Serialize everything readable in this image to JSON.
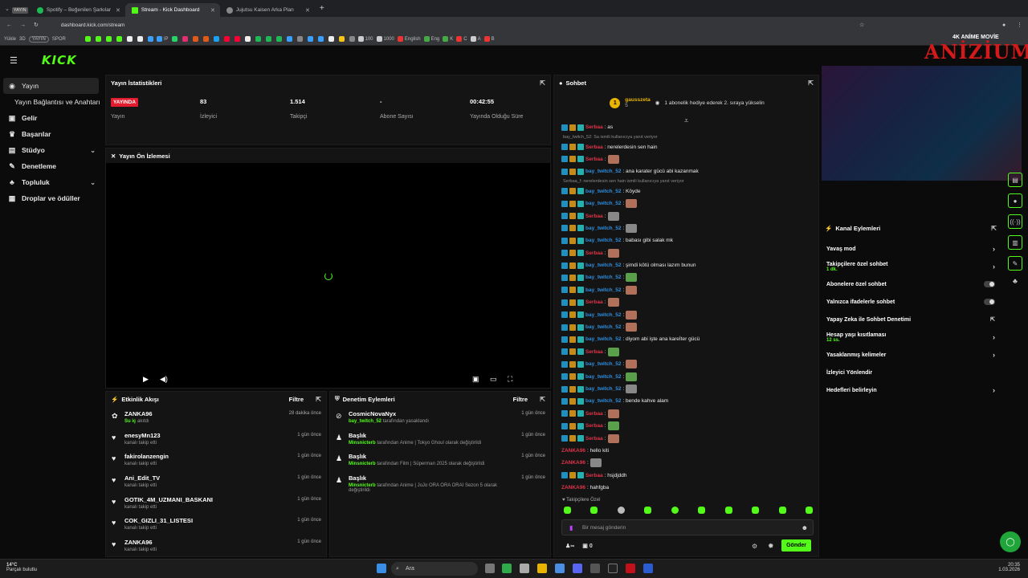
{
  "browser": {
    "tabs": [
      {
        "label": "YAYIN"
      },
      {
        "label": "Spotify – Beğenilen Şarkılar"
      },
      {
        "label": "Stream - Kick Dashboard"
      },
      {
        "label": "Jujutsu Kaisen Arka Plan"
      }
    ],
    "url": "dashboard.kick.com/stream",
    "bookmarks": [
      "Yükle",
      "3D",
      "YAYIN",
      "SPOR",
      "IP",
      "100",
      "1000",
      "English",
      "Eng",
      "K",
      "C",
      "A",
      "B"
    ]
  },
  "watermark": {
    "top": "4K ANİME MOVİE",
    "brand": "ANİZİUM"
  },
  "sidebar": {
    "items": [
      {
        "label": "Yayın",
        "icon": "broadcast-icon"
      },
      {
        "label": "Yayın Bağlantısı ve Anahtarı"
      },
      {
        "label": "Gelir",
        "icon": "money-icon"
      },
      {
        "label": "Başarılar",
        "icon": "trophy-icon"
      },
      {
        "label": "Stüdyo",
        "icon": "studio-icon"
      },
      {
        "label": "Denetleme",
        "icon": "wrench-icon"
      },
      {
        "label": "Topluluk",
        "icon": "community-icon"
      },
      {
        "label": "Droplar ve ödüller",
        "icon": "gift-icon"
      }
    ]
  },
  "stats": {
    "title": "Yayın İstatistikleri",
    "live_badge": "YAYINDA",
    "cells": [
      {
        "value": "",
        "label": "Yayın"
      },
      {
        "value": "83",
        "label": "İzleyici"
      },
      {
        "value": "1.514",
        "label": "Takipçi"
      },
      {
        "value": "-",
        "label": "Abone Sayısı"
      },
      {
        "value": "00:42:55",
        "label": "Yayında Olduğu Süre"
      }
    ]
  },
  "preview": {
    "title": "Yayın Ön İzlemesi"
  },
  "activity": {
    "title": "Etkinlik Akışı",
    "filter": "Filtre",
    "rows": [
      {
        "name": "ZANKA96",
        "sub": "Su iç",
        "sub2": "akıtdı",
        "time": "28 dakika önce"
      },
      {
        "name": "enesyMn123",
        "sub": "kanalı takip etti",
        "time": "1 gün önce"
      },
      {
        "name": "fakirolanzengin",
        "sub": "kanalı takip etti",
        "time": "1 gün önce"
      },
      {
        "name": "Ani_Edit_TV",
        "sub": "kanalı takip etti",
        "time": "1 gün önce"
      },
      {
        "name": "GOTIK_4M_UZMANI_BASKANI",
        "sub": "kanalı takip etti",
        "time": "1 gün önce"
      },
      {
        "name": "COK_GIZLI_31_LISTESI",
        "sub": "kanalı takip etti",
        "time": "1 gün önce"
      },
      {
        "name": "ZANKA96",
        "sub": "kanalı takip etti",
        "time": "1 gün önce"
      }
    ]
  },
  "moderation": {
    "title": "Denetim Eylemleri",
    "filter": "Filtre",
    "rows": [
      {
        "name": "CosmicNovaNyx",
        "actor": "bay_twitch_52",
        "text": "tarafından yasaklandı",
        "time": "1 gün önce"
      },
      {
        "name": "Başlık",
        "actor": "Minsnicterb",
        "text": "tarafından  Anime | Tokyo Ghoul olarak değiştirildi",
        "time": "1 gün önce"
      },
      {
        "name": "Başlık",
        "actor": "Minsnicterb",
        "text": "tarafından  Film | Süperman 2025 olarak değiştirildi",
        "time": "1 gün önce"
      },
      {
        "name": "Başlık",
        "actor": "Minsnicterb",
        "text": "tarafından  Anime | JoJo  ORA ORA ORAI Sezon 5 olarak değiştirildi",
        "time": "1 gün önce"
      }
    ]
  },
  "chat": {
    "title": "Sohbet",
    "pinned_user": "gausszeta",
    "pinned_level": "5",
    "pinned_text": "1 abonelik hediye ederek 2. sıraya yükselin",
    "messages": [
      {
        "user": "Serbaa",
        "text": ": as",
        "color": "#e0344a"
      },
      {
        "reply": "bay_twitch_52: Sa ismili kullanıcıya yanıt veriyor"
      },
      {
        "user": "Serbaa",
        "text": ": nerelerdesin sen hain",
        "color": "#e0344a"
      },
      {
        "user": "Serbaa",
        "text": ":",
        "color": "#e0344a",
        "emote": "emote"
      },
      {
        "user": "bay_twitch_52",
        "text": ": ana karater gücü abi kazanmak",
        "color": "#2f8fe0"
      },
      {
        "reply": "Serbaa_f: nerelerdesin sen hain ismili kullanıcıya yanıt veriyor"
      },
      {
        "user": "bay_twitch_52",
        "text": ": Köyde",
        "color": "#2f8fe0"
      },
      {
        "user": "bay_twitch_52",
        "text": ":",
        "color": "#2f8fe0",
        "emote": "emote"
      },
      {
        "user": "Serbaa",
        "text": ":",
        "color": "#e0344a",
        "emote": "emote g"
      },
      {
        "user": "bay_twitch_52",
        "text": ":",
        "color": "#2f8fe0",
        "emote": "emote g"
      },
      {
        "user": "bay_twitch_52",
        "text": ": babası gibi salak mk",
        "color": "#2f8fe0"
      },
      {
        "user": "Serbaa",
        "text": ":",
        "color": "#e0344a",
        "emote": "emote"
      },
      {
        "user": "bay_twitch_52",
        "text": ": şimdi kötü olması lazım bunun",
        "color": "#2f8fe0"
      },
      {
        "user": "bay_twitch_52",
        "text": ":",
        "color": "#2f8fe0",
        "emote": "emote f"
      },
      {
        "user": "bay_twitch_52",
        "text": ":",
        "color": "#2f8fe0",
        "emote": "emote"
      },
      {
        "user": "Serbaa",
        "text": ":",
        "color": "#e0344a",
        "emote": "emote"
      },
      {
        "user": "bay_twitch_52",
        "text": ":",
        "color": "#2f8fe0",
        "emote": "emote"
      },
      {
        "user": "bay_twitch_52",
        "text": ":",
        "color": "#2f8fe0",
        "emote": "emote"
      },
      {
        "user": "bay_twitch_52",
        "text": ": diyom abi işte ana kareİter gücü",
        "color": "#2f8fe0"
      },
      {
        "user": "Serbaa",
        "text": ":",
        "color": "#e0344a",
        "emote": "emote f"
      },
      {
        "user": "bay_twitch_52",
        "text": ":",
        "color": "#2f8fe0",
        "emote": "emote"
      },
      {
        "user": "bay_twitch_52",
        "text": ":",
        "color": "#2f8fe0",
        "emote": "emote f"
      },
      {
        "user": "bay_twitch_52",
        "text": ":",
        "color": "#2f8fe0",
        "emote": "emote g"
      },
      {
        "user": "bay_twitch_52",
        "text": ": bende kahve alam",
        "color": "#2f8fe0"
      },
      {
        "user": "Serbaa",
        "text": ":",
        "color": "#e0344a",
        "emote": "emote"
      },
      {
        "user": "Serbaa",
        "text": ":",
        "color": "#e0344a",
        "emote": "emote f"
      },
      {
        "user": "Serbaa",
        "text": ":",
        "color": "#e0344a",
        "emote": "emote"
      },
      {
        "user": "ZANKA96",
        "text": ": hello kiti",
        "color": "#e0344a",
        "nobadge": true
      },
      {
        "user": "ZANKA96",
        "text": ":",
        "color": "#e0344a",
        "nobadge": true,
        "emote": "emote g"
      },
      {
        "user": "Serbaa",
        "text": ": hsjdjddh",
        "color": "#e0344a"
      },
      {
        "user": "ZANKA96",
        "text": ": hahfgba",
        "color": "#e0344a",
        "nobadge": true
      }
    ],
    "followers_only": "Takipçilere Özel",
    "input_placeholder": "Bir mesaj gönderin",
    "viewers": "∞",
    "count": "0",
    "send": "Gönder"
  },
  "channel": {
    "title": "Kanal Eylemleri",
    "items": [
      {
        "label": "Yavaş mod",
        "kind": "chev"
      },
      {
        "label": "Takipçilere özel sohbet",
        "sub": "1 dk.",
        "kind": "chev"
      },
      {
        "label": "Abonelere özel sohbet",
        "kind": "toggle"
      },
      {
        "label": "Yalnızca ifadelerle sohbet",
        "kind": "toggle"
      },
      {
        "label": "Yapay Zeka ile Sohbet Denetimi",
        "kind": "ext"
      },
      {
        "label": "Hesap yaşı kısıtlaması",
        "sub": "12 ss.",
        "kind": "chev"
      },
      {
        "label": "Yasaklanmış kelimeler",
        "kind": "chev"
      },
      {
        "label": "İzleyici Yönlendir",
        "kind": "none"
      },
      {
        "label": "Hedefleri belirleyin",
        "kind": "chev"
      }
    ]
  },
  "taskbar": {
    "temp": "14°C",
    "weather": "Parçalı bulutlu",
    "search": "Ara",
    "time": "20:35",
    "date": "1.03.2026"
  },
  "colors": {
    "accent": "#53fc18",
    "live": "#e01c2e",
    "bg": "#0b0b0b",
    "panel": "#141414"
  }
}
